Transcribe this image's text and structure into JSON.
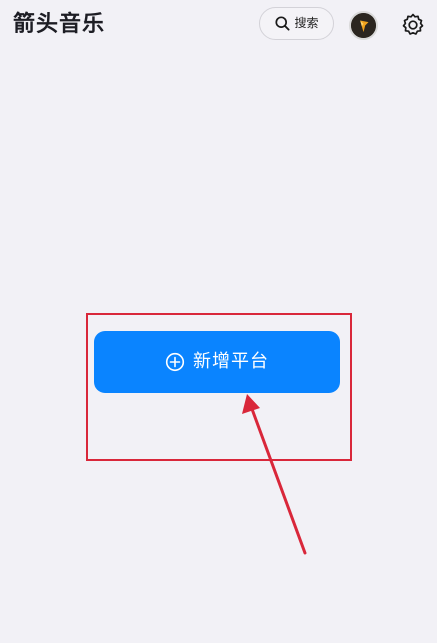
{
  "header": {
    "title": "箭头音乐",
    "search_label": "搜索",
    "search_icon": "search-icon",
    "avatar_icon": "avatar-icon",
    "settings_icon": "gear-icon"
  },
  "main": {
    "add_button_label": "新增平台",
    "add_button_icon": "plus-circle-icon"
  },
  "colors": {
    "background": "#f2f1f6",
    "accent": "#0a84ff",
    "annotation": "#d9273a"
  }
}
